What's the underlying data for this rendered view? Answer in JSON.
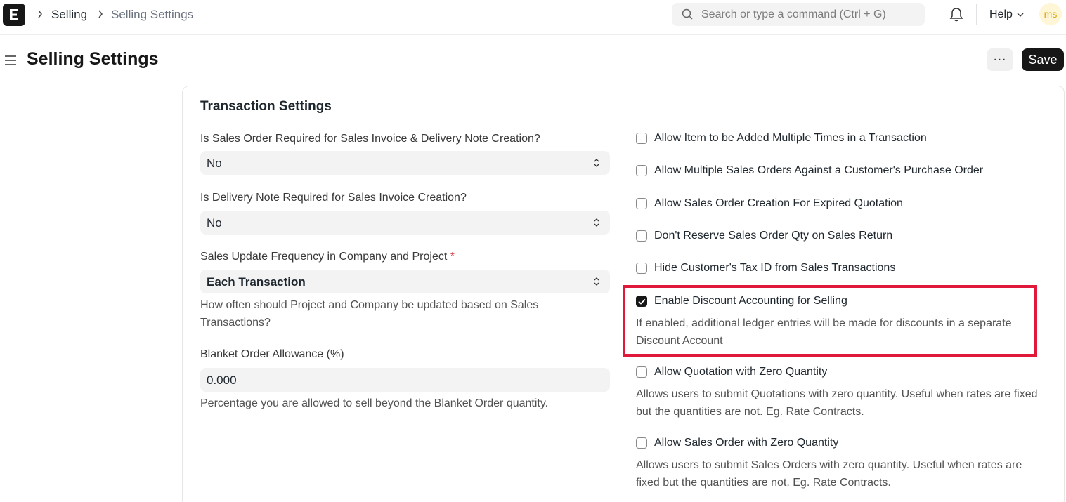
{
  "navbar": {
    "breadcrumbs": [
      "Selling",
      "Selling Settings"
    ],
    "search_placeholder": "Search or type a command (Ctrl + G)",
    "help_label": "Help",
    "avatar_initials": "ms"
  },
  "page": {
    "title": "Selling Settings",
    "more_label": "···",
    "save_label": "Save"
  },
  "section": {
    "title": "Transaction Settings"
  },
  "left_fields": {
    "so_required": {
      "label": "Is Sales Order Required for Sales Invoice & Delivery Note Creation?",
      "value": "No"
    },
    "dn_required": {
      "label": "Is Delivery Note Required for Sales Invoice Creation?",
      "value": "No"
    },
    "sales_update_frequency": {
      "label": "Sales Update Frequency in Company and Project",
      "required_mark": "*",
      "value": "Each Transaction",
      "description": "How often should Project and Company be updated based on Sales Transactions?"
    },
    "blanket_order_allowance": {
      "label": "Blanket Order Allowance (%)",
      "value": "0.000",
      "description": "Percentage you are allowed to sell beyond the Blanket Order quantity."
    }
  },
  "checkboxes": [
    {
      "label": "Allow Item to be Added Multiple Times in a Transaction",
      "checked": false,
      "description": ""
    },
    {
      "label": "Allow Multiple Sales Orders Against a Customer's Purchase Order",
      "checked": false,
      "description": ""
    },
    {
      "label": "Allow Sales Order Creation For Expired Quotation",
      "checked": false,
      "description": ""
    },
    {
      "label": "Don't Reserve Sales Order Qty on Sales Return",
      "checked": false,
      "description": ""
    },
    {
      "label": "Hide Customer's Tax ID from Sales Transactions",
      "checked": false,
      "description": ""
    },
    {
      "label": "Enable Discount Accounting for Selling",
      "checked": true,
      "description": "If enabled, additional ledger entries will be made for discounts in a separate Discount Account"
    },
    {
      "label": "Allow Quotation with Zero Quantity",
      "checked": false,
      "description": "Allows users to submit Quotations with zero quantity. Useful when rates are fixed but the quantities are not. Eg. Rate Contracts."
    },
    {
      "label": "Allow Sales Order with Zero Quantity",
      "checked": false,
      "description": "Allows users to submit Sales Orders with zero quantity. Useful when rates are fixed but the quantities are not. Eg. Rate Contracts."
    }
  ],
  "colors": {
    "highlight": "#e0193a",
    "primary_button": "#171717"
  }
}
